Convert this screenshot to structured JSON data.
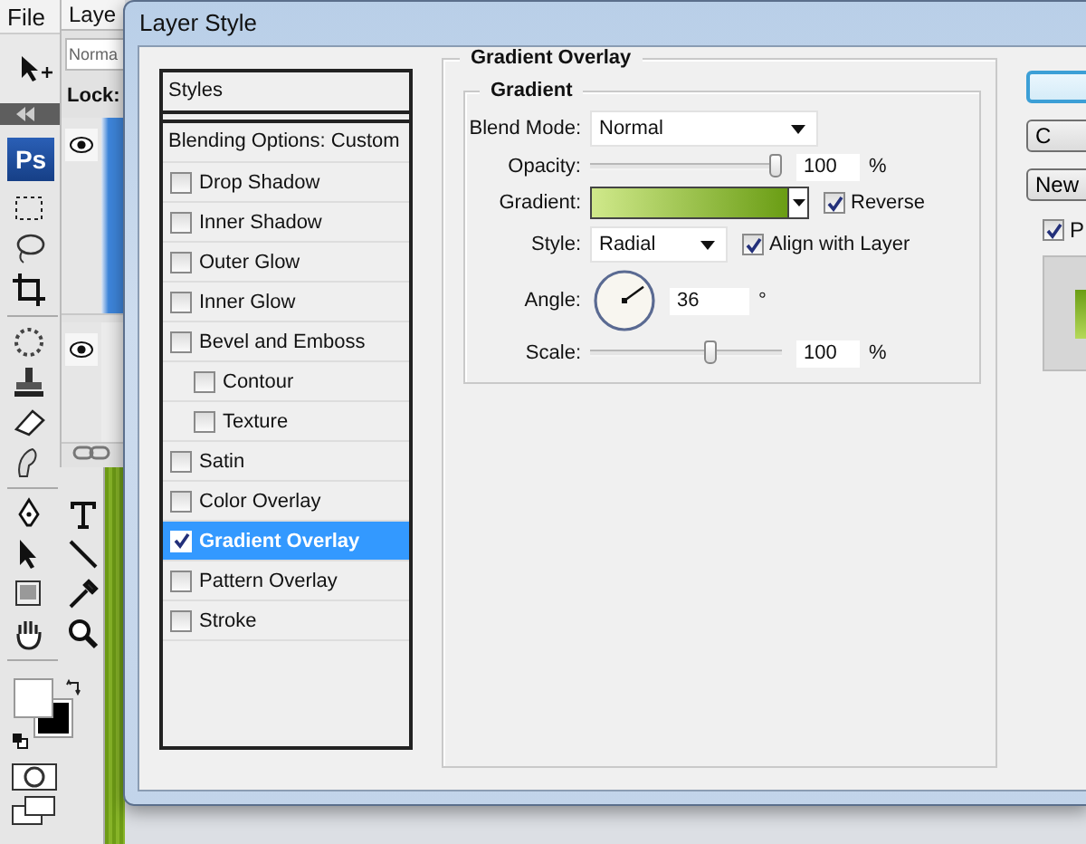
{
  "app": {
    "menu": [
      {
        "label": "File"
      }
    ],
    "panel_tab": {
      "label": "Laye"
    },
    "blend_field": {
      "value": "Norma"
    },
    "lock_label": "Lock:",
    "logo": "Ps",
    "layers": [
      {
        "visible": true,
        "selected": true
      },
      {
        "visible": true,
        "selected": false
      }
    ]
  },
  "dialog": {
    "title": "Layer Style",
    "styles_header": "Styles",
    "blending_options": "Blending Options: Custom",
    "effects": [
      {
        "label": "Drop Shadow",
        "checked": false,
        "selected": false
      },
      {
        "label": "Inner Shadow",
        "checked": false,
        "selected": false
      },
      {
        "label": "Outer Glow",
        "checked": false,
        "selected": false
      },
      {
        "label": "Inner Glow",
        "checked": false,
        "selected": false
      },
      {
        "label": "Bevel and Emboss",
        "checked": false,
        "selected": false,
        "children": [
          {
            "label": "Contour",
            "checked": false,
            "selected": false
          },
          {
            "label": "Texture",
            "checked": false,
            "selected": false
          }
        ]
      },
      {
        "label": "Satin",
        "checked": false,
        "selected": false
      },
      {
        "label": "Color Overlay",
        "checked": false,
        "selected": false
      },
      {
        "label": "Gradient Overlay",
        "checked": true,
        "selected": true
      },
      {
        "label": "Pattern Overlay",
        "checked": false,
        "selected": false
      },
      {
        "label": "Stroke",
        "checked": false,
        "selected": false
      }
    ],
    "panel": {
      "title": "Gradient Overlay",
      "group": "Gradient",
      "blend_mode": {
        "label": "Blend Mode:",
        "value": "Normal"
      },
      "opacity": {
        "label": "Opacity:",
        "level": 1,
        "value": "100",
        "unit": "%"
      },
      "gradient": {
        "label": "Gradient:"
      },
      "reverse": {
        "label": "Reverse",
        "checked": true
      },
      "style": {
        "label": "Style:",
        "value": "Radial"
      },
      "align": {
        "label": "Align with Layer",
        "checked": true
      },
      "angle": {
        "label": "Angle:",
        "value": "36",
        "unit": "°"
      },
      "scale": {
        "label": "Scale:",
        "level": 0.64,
        "value": "100",
        "unit": "%"
      }
    },
    "buttons": [
      {
        "kind": "default"
      },
      {
        "kind": "normal",
        "label": "C"
      },
      {
        "kind": "normal",
        "label": "New"
      }
    ],
    "preview": {
      "label": "P",
      "checked": true
    }
  }
}
